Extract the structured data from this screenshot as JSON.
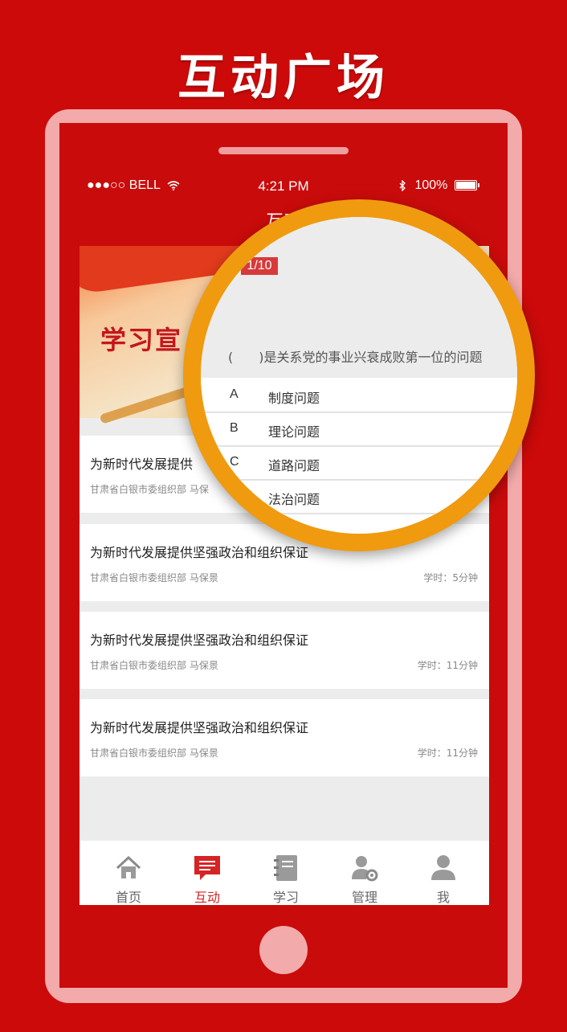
{
  "headline": "互动广场",
  "status_bar": {
    "carrier": "●●●○○ BELL",
    "time": "4:21 PM",
    "battery": "100%"
  },
  "app_title": "互动",
  "banner": {
    "text": "学习宣"
  },
  "articles": [
    {
      "title": "为新时代发展提供",
      "meta": "甘肃省白银市委组织部 马保",
      "time": ""
    },
    {
      "title": "为新时代发展提供坚强政治和组织保证",
      "meta": "甘肃省白银市委组织部 马保景",
      "time": "学时：5分钟"
    },
    {
      "title": "为新时代发展提供坚强政治和组织保证",
      "meta": "甘肃省白银市委组织部 马保景",
      "time": "学时：11分钟"
    },
    {
      "title": "为新时代发展提供坚强政治和组织保证",
      "meta": "甘肃省白银市委组织部 马保景",
      "time": "学时：11分钟"
    }
  ],
  "tabs": [
    {
      "label": "首页",
      "icon": "home-icon"
    },
    {
      "label": "互动",
      "icon": "chat-icon",
      "active": true
    },
    {
      "label": "学习",
      "icon": "notebook-icon"
    },
    {
      "label": "管理",
      "icon": "user-gear-icon"
    },
    {
      "label": "我",
      "icon": "person-icon"
    }
  ],
  "quiz": {
    "progress": "1/10",
    "question": "(　　)是关系党的事业兴衰成败第一位的问题",
    "options": [
      {
        "letter": "A",
        "text": "制度问题"
      },
      {
        "letter": "B",
        "text": "理论问题"
      },
      {
        "letter": "C",
        "text": "道路问题"
      },
      {
        "letter": "",
        "text": "法治问题"
      }
    ]
  },
  "colors": {
    "brand_red": "#cc0a0a",
    "accent_orange": "#f09a10",
    "active_tab": "#d52424"
  }
}
